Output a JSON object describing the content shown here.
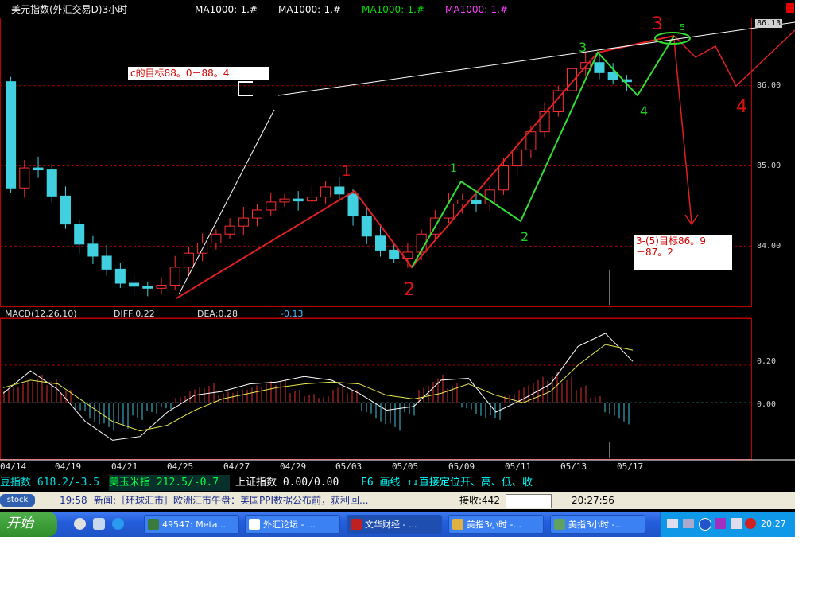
{
  "header": {
    "title": "美元指数(外汇交易D)3小时",
    "ma_labels": [
      {
        "text": "MA1000:-1.#",
        "color": "#ffffff"
      },
      {
        "text": "MA1000:-1.#",
        "color": "#ffffff"
      },
      {
        "text": "MA1000:-1.#",
        "color": "#00e000"
      },
      {
        "text": "MA1000:-1.#",
        "color": "#ff00ff"
      }
    ]
  },
  "price_axis": {
    "labels": [
      "86.00",
      "85.00",
      "84.00"
    ],
    "current": "86.13"
  },
  "macd": {
    "title": "MACD(12,26,10)",
    "diff": "DIFF:0.22",
    "dea": "DEA:0.28",
    "value": "-0.13",
    "axis_labels": [
      "0.20",
      "0.00"
    ]
  },
  "x_axis": {
    "labels": [
      "04/14",
      "04/19",
      "04/21",
      "04/25",
      "04/27",
      "04/29",
      "05/03",
      "05/05",
      "05/09",
      "05/11",
      "05/13",
      "05/17"
    ]
  },
  "annotations": {
    "c_target": "c的目标88。0－88。4",
    "wave35_target_line1": "3-(5)目标86。9",
    "wave35_target_line2": "－87。2",
    "wave_labels": {
      "w1": "1",
      "w2": "2",
      "w3": "3",
      "w4": "4",
      "w5": "5",
      "g1": "1",
      "g2": "2",
      "g3": "3",
      "g4": "4",
      "g5": "5"
    }
  },
  "ticker": {
    "item1": "豆指数 618.2/-3.5",
    "item2": "美玉米指 212.5/-0.7",
    "item3": "上证指数  0.00/0.00",
    "hint": "F6 画线   ↑↓直接定位开、高、低、收"
  },
  "newsbar": {
    "logo": "stock",
    "time": "19:58",
    "news": "新闻:［环球汇市］欧洲汇市午盘：美国PPI数据公布前，获利回...",
    "receive_label": "接收:442",
    "receive_value": "",
    "clock": "20:27:56"
  },
  "taskbar": {
    "start": "开始",
    "windows": [
      "49547: Meta...",
      "外汇论坛 - ...",
      "文华财经 - ...",
      "美指3小时 -...",
      "美指3小时 -..."
    ],
    "clock": "20:27"
  },
  "chart_data": {
    "type": "candlestick",
    "title": "美元指数(外汇交易D)3小时",
    "x_labels": [
      "04/14",
      "04/19",
      "04/21",
      "04/25",
      "04/27",
      "04/29",
      "05/03",
      "05/05",
      "05/09",
      "05/11",
      "05/13",
      "05/17"
    ],
    "price_axis": {
      "ticks": [
        84.0,
        85.0,
        86.0
      ],
      "last": 86.13,
      "ylim": [
        83.25,
        86.85
      ]
    },
    "price_path": [
      [
        0,
        84.6
      ],
      [
        2,
        85.1
      ],
      [
        3,
        84.8
      ],
      [
        5,
        84.1
      ],
      [
        7,
        83.8
      ],
      [
        9,
        83.45
      ],
      [
        10,
        83.55
      ],
      [
        11,
        83.4
      ],
      [
        13,
        83.85
      ],
      [
        15,
        84.1
      ],
      [
        17,
        84.3
      ],
      [
        19,
        84.5
      ],
      [
        20,
        84.6
      ],
      [
        22,
        84.55
      ],
      [
        24,
        84.8
      ],
      [
        25,
        84.5
      ],
      [
        27,
        84.0
      ],
      [
        29,
        83.8
      ],
      [
        30,
        84.05
      ],
      [
        32,
        84.45
      ],
      [
        33,
        84.6
      ],
      [
        35,
        84.5
      ],
      [
        36,
        84.9
      ],
      [
        38,
        85.3
      ],
      [
        40,
        85.8
      ],
      [
        42,
        86.35
      ],
      [
        44,
        86.1
      ],
      [
        45,
        86.05
      ]
    ],
    "macd": {
      "title": "MACD(12,26,10)",
      "diff": 0.22,
      "dea": 0.28,
      "macd": -0.13,
      "axis_ticks": [
        0.0,
        0.2
      ],
      "ylim": [
        -0.3,
        0.45
      ],
      "diff_path": [
        [
          0,
          0.05
        ],
        [
          2,
          0.17
        ],
        [
          4,
          0.07
        ],
        [
          6,
          -0.1
        ],
        [
          8,
          -0.2
        ],
        [
          10,
          -0.18
        ],
        [
          12,
          -0.05
        ],
        [
          14,
          0.04
        ],
        [
          16,
          0.06
        ],
        [
          18,
          0.1
        ],
        [
          20,
          0.11
        ],
        [
          22,
          0.14
        ],
        [
          24,
          0.12
        ],
        [
          26,
          0.05
        ],
        [
          28,
          -0.04
        ],
        [
          30,
          -0.02
        ],
        [
          32,
          0.12
        ],
        [
          34,
          0.13
        ],
        [
          36,
          -0.05
        ],
        [
          38,
          0.02
        ],
        [
          40,
          0.1
        ],
        [
          42,
          0.3
        ],
        [
          44,
          0.37
        ],
        [
          46,
          0.22
        ]
      ],
      "dea_path": [
        [
          0,
          0.08
        ],
        [
          2,
          0.12
        ],
        [
          4,
          0.1
        ],
        [
          6,
          0.0
        ],
        [
          8,
          -0.1
        ],
        [
          10,
          -0.15
        ],
        [
          12,
          -0.12
        ],
        [
          14,
          -0.04
        ],
        [
          16,
          0.02
        ],
        [
          18,
          0.05
        ],
        [
          20,
          0.08
        ],
        [
          22,
          0.1
        ],
        [
          24,
          0.11
        ],
        [
          26,
          0.1
        ],
        [
          28,
          0.04
        ],
        [
          30,
          0.02
        ],
        [
          32,
          0.05
        ],
        [
          34,
          0.1
        ],
        [
          36,
          0.04
        ],
        [
          38,
          0.0
        ],
        [
          40,
          0.06
        ],
        [
          42,
          0.2
        ],
        [
          44,
          0.31
        ],
        [
          46,
          0.28
        ]
      ],
      "histogram": [
        0.07,
        0.1,
        0.13,
        0.11,
        0.06,
        -0.04,
        -0.1,
        -0.13,
        -0.12,
        -0.08,
        -0.05,
        -0.03,
        0.03,
        0.07,
        0.09,
        0.05,
        0.06,
        0.08,
        0.1,
        0.11,
        0.06,
        0.04,
        0.03,
        0.08,
        0.06,
        -0.05,
        -0.1,
        -0.13,
        -0.06,
        0.08,
        0.13,
        0.09,
        -0.03,
        -0.07,
        -0.08,
        0.04,
        0.08,
        0.12,
        0.14,
        0.12,
        0.08,
        0.03,
        -0.06,
        -0.1
      ]
    }
  }
}
